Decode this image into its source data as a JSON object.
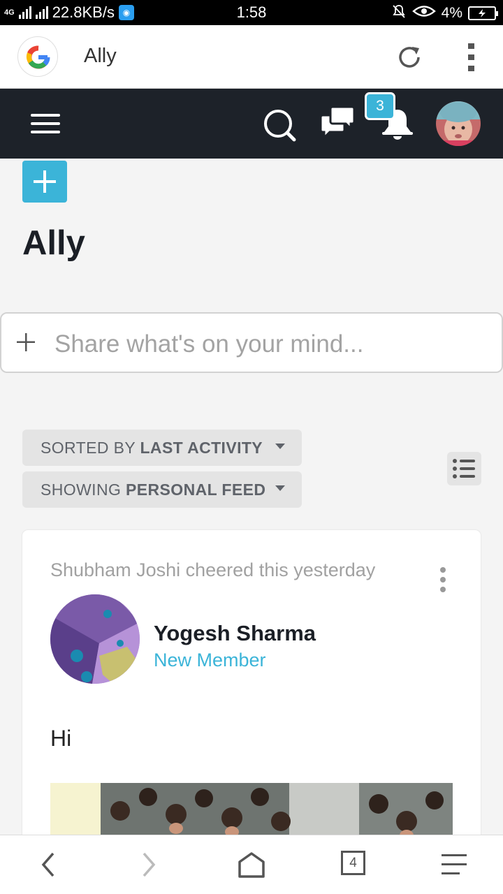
{
  "status_bar": {
    "network": "4G",
    "speed": "22.8KB/s",
    "time": "1:58",
    "battery": "4%"
  },
  "browser": {
    "title": "Ally"
  },
  "header": {
    "notification_count": "3"
  },
  "page": {
    "title": "Ally"
  },
  "composer": {
    "placeholder": "Share what's on your mind..."
  },
  "filters": {
    "sort_prefix": "SORTED BY",
    "sort_value": "LAST ACTIVITY",
    "show_prefix": "SHOWING",
    "show_value": "PERSONAL FEED"
  },
  "post": {
    "activity": "Shubham Joshi cheered this yesterday",
    "author_name": "Yogesh Sharma",
    "author_role": "New Member",
    "text": "Hi"
  },
  "bottom_nav": {
    "tab_count": "4"
  },
  "colors": {
    "accent": "#3bb4d8",
    "header_bg": "#1d2229",
    "page_bg": "#f4f4f4"
  }
}
